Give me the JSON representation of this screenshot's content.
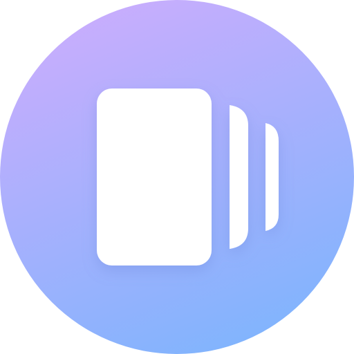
{
  "app_icon": {
    "icon_name": "card-stack-icon",
    "colors": {
      "gradient_start": "#C9ADFD",
      "gradient_end": "#7FB4FD",
      "card_fill": "#FFFFFF",
      "shadow": "#6D86D9"
    }
  }
}
